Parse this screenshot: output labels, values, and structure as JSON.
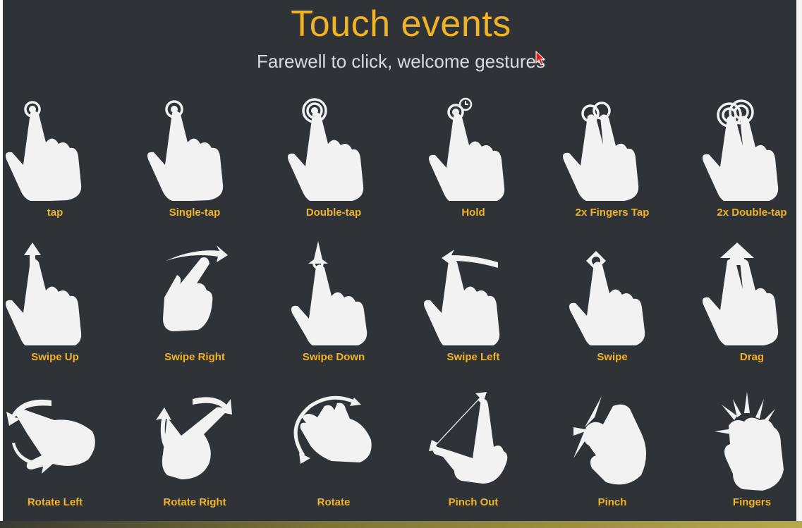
{
  "title": "Touch events",
  "subtitle": "Farewell to click, welcome gestures",
  "gestures": [
    {
      "label": "tap",
      "icon": "tap-icon"
    },
    {
      "label": "Single-tap",
      "icon": "single-tap-icon"
    },
    {
      "label": "Double-tap",
      "icon": "double-tap-icon"
    },
    {
      "label": "Hold",
      "icon": "hold-icon"
    },
    {
      "label": "2x Fingers Tap",
      "icon": "two-finger-tap-icon"
    },
    {
      "label": "2x Double-tap",
      "icon": "two-finger-double-tap-icon"
    },
    {
      "label": "Swipe Up",
      "icon": "swipe-up-icon"
    },
    {
      "label": "Swipe Right",
      "icon": "swipe-right-icon"
    },
    {
      "label": "Swipe Down",
      "icon": "swipe-down-icon"
    },
    {
      "label": "Swipe Left",
      "icon": "swipe-left-icon"
    },
    {
      "label": "Swipe",
      "icon": "swipe-icon"
    },
    {
      "label": "Drag",
      "icon": "drag-icon"
    },
    {
      "label": "Rotate Left",
      "icon": "rotate-left-icon"
    },
    {
      "label": "Rotate Right",
      "icon": "rotate-right-icon"
    },
    {
      "label": "Rotate",
      "icon": "rotate-icon"
    },
    {
      "label": "Pinch Out",
      "icon": "pinch-out-icon"
    },
    {
      "label": "Pinch",
      "icon": "pinch-icon"
    },
    {
      "label": "Fingers",
      "icon": "fingers-icon"
    }
  ],
  "colors": {
    "background": "#2f3338",
    "accent": "#f0b323",
    "text": "#d9dcdf",
    "icon": "#f2f2f2"
  }
}
